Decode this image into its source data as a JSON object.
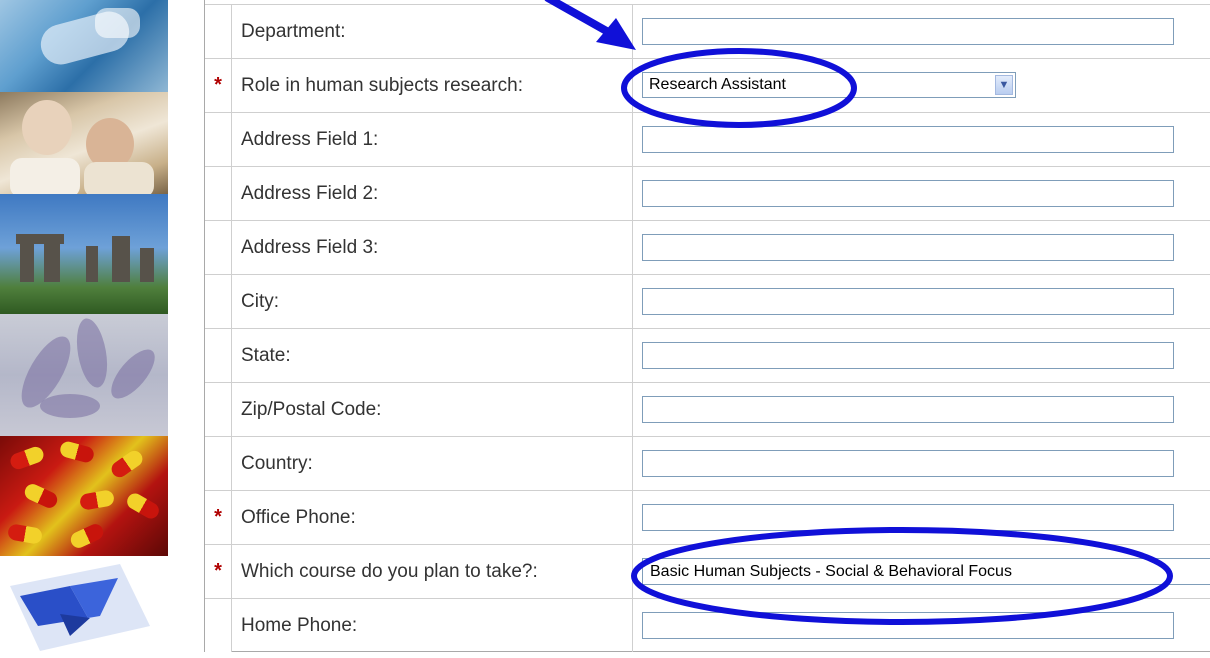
{
  "form": {
    "rows": [
      {
        "label": "Department:",
        "required": false,
        "type": "text",
        "value": ""
      },
      {
        "label": "Role in human subjects research:",
        "required": true,
        "type": "select",
        "value": "Research Assistant"
      },
      {
        "label": "Address Field 1:",
        "required": false,
        "type": "text",
        "value": ""
      },
      {
        "label": "Address Field 2:",
        "required": false,
        "type": "text",
        "value": ""
      },
      {
        "label": "Address Field 3:",
        "required": false,
        "type": "text",
        "value": ""
      },
      {
        "label": "City:",
        "required": false,
        "type": "text",
        "value": ""
      },
      {
        "label": "State:",
        "required": false,
        "type": "text",
        "value": ""
      },
      {
        "label": "Zip/Postal Code:",
        "required": false,
        "type": "text",
        "value": ""
      },
      {
        "label": "Country:",
        "required": false,
        "type": "text",
        "value": ""
      },
      {
        "label": "Office Phone:",
        "required": true,
        "type": "text",
        "value": ""
      },
      {
        "label": "Which course do you plan to take?:",
        "required": true,
        "type": "course",
        "value": "Basic Human Subjects - Social & Behavioral Focus"
      },
      {
        "label": "Home Phone:",
        "required": false,
        "type": "text",
        "value": ""
      }
    ],
    "required_marker": "*",
    "select_arrow_icon": "chevron-down-icon"
  },
  "annotation": {
    "color": "#1010d8",
    "marks": [
      "arrow pointing to Department field",
      "ellipse around Role selection",
      "ellipse around course selection"
    ]
  },
  "side_images": [
    "surgery",
    "elderly-couple",
    "stonehenge",
    "cells",
    "pills",
    "butterfly"
  ]
}
